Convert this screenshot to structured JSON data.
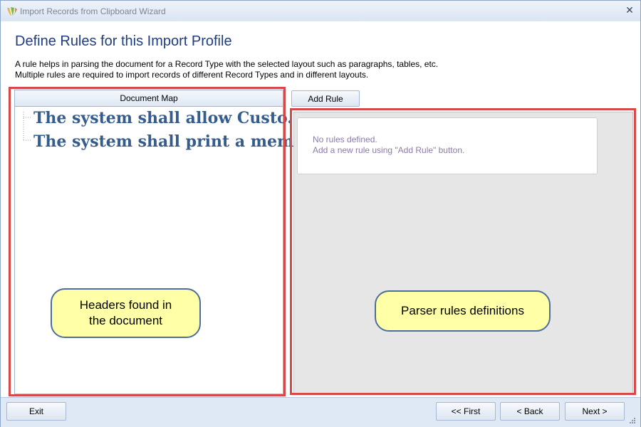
{
  "window": {
    "title": "Import Records from Clipboard Wizard",
    "close_symbol": "✕"
  },
  "page": {
    "heading": "Define Rules for this Import Profile",
    "description_line1": "A rule helps in parsing the document for a Record Type with the selected layout such as paragraphs, tables, etc.",
    "description_line2": "Multiple rules are required to import records of different Record Types and in different layouts."
  },
  "document_map": {
    "header": "Document Map",
    "items": [
      "The system shall allow Custo...",
      "The system shall print a mem..."
    ]
  },
  "rules": {
    "add_rule_label": "Add Rule",
    "empty_line1": "No rules defined.",
    "empty_line2": "Add a new rule using \"Add Rule\" button."
  },
  "callouts": {
    "left_line1": "Headers found in",
    "left_line2": "the document",
    "right": "Parser rules definitions"
  },
  "footer": {
    "exit_label": "Exit",
    "first_label": "<< First",
    "back_label": "< Back",
    "next_label": "Next >"
  },
  "colors": {
    "heading": "#1f3d82",
    "highlight_border": "#d94848",
    "callout_fill": "#ffffa8",
    "tree_text": "#355c8c",
    "empty_text": "#8c7aa9"
  },
  "icons": {
    "app": "app-logo-icon",
    "close": "close-icon",
    "grip": "resize-grip-icon"
  }
}
